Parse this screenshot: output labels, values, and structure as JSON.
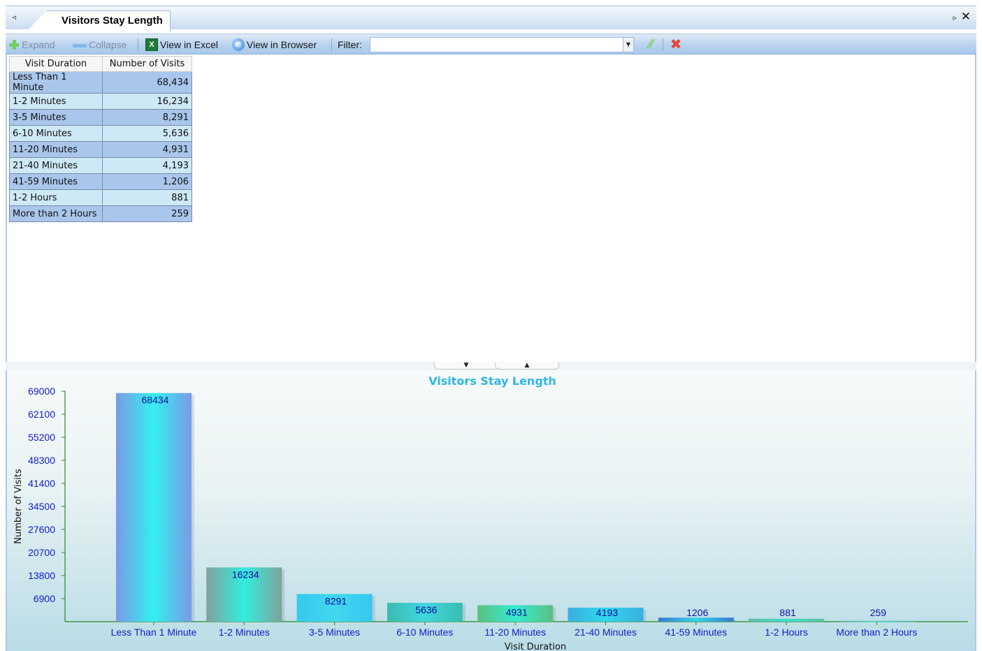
{
  "tab": {
    "title": "Visitors Stay Length",
    "prev_glyph": "◃",
    "next_glyph": "▹",
    "close_glyph": "✕"
  },
  "toolbar": {
    "expand_label": "Expand",
    "collapse_label": "Collapse",
    "view_excel_label": "View in Excel",
    "view_browser_label": "View in Browser",
    "filter_label": "Filter:",
    "filter_value": ""
  },
  "grid": {
    "headers": [
      "Visit Duration",
      "Number of Visits"
    ],
    "rows": [
      [
        "Less Than 1 Minute",
        "68,434"
      ],
      [
        "1-2 Minutes",
        "16,234"
      ],
      [
        "3-5 Minutes",
        "8,291"
      ],
      [
        "6-10 Minutes",
        "5,636"
      ],
      [
        "11-20 Minutes",
        "4,931"
      ],
      [
        "21-40 Minutes",
        "4,193"
      ],
      [
        "41-59 Minutes",
        "1,206"
      ],
      [
        "1-2 Hours",
        "881"
      ],
      [
        "More than 2 Hours",
        "259"
      ]
    ]
  },
  "chart_data": {
    "type": "bar",
    "title": "Visitors Stay Length",
    "xlabel": "Visit Duration",
    "ylabel": "Number of Visits",
    "categories": [
      "Less Than 1 Minute",
      "1-2 Minutes",
      "3-5 Minutes",
      "6-10 Minutes",
      "11-20 Minutes",
      "21-40 Minutes",
      "41-59 Minutes",
      "1-2 Hours",
      "More than 2 Hours"
    ],
    "values": [
      68434,
      16234,
      8291,
      5636,
      4931,
      4193,
      1206,
      881,
      259
    ],
    "yticks": [
      6900,
      13800,
      20700,
      27600,
      34500,
      41400,
      48300,
      55200,
      62100,
      69000
    ],
    "ylim": [
      0,
      69000
    ],
    "grid": false,
    "legend": "none",
    "bar_colors": [
      [
        "#7a9ae6",
        "#33f0f0"
      ],
      [
        "#7fa39a",
        "#33ece0"
      ],
      [
        "#38c8ef",
        "#40d8ef"
      ],
      [
        "#3abcb0",
        "#40d6e0"
      ],
      [
        "#5cbf80",
        "#33ecd0"
      ],
      [
        "#3aaee0",
        "#30d8ec"
      ],
      [
        "#3a7ad0",
        "#33d6e8"
      ],
      [
        "#5cc0a0",
        "#40e0d0"
      ],
      [
        "#70b0a0",
        "#50d8c8"
      ]
    ],
    "axis_color": "#2a8a2a"
  }
}
